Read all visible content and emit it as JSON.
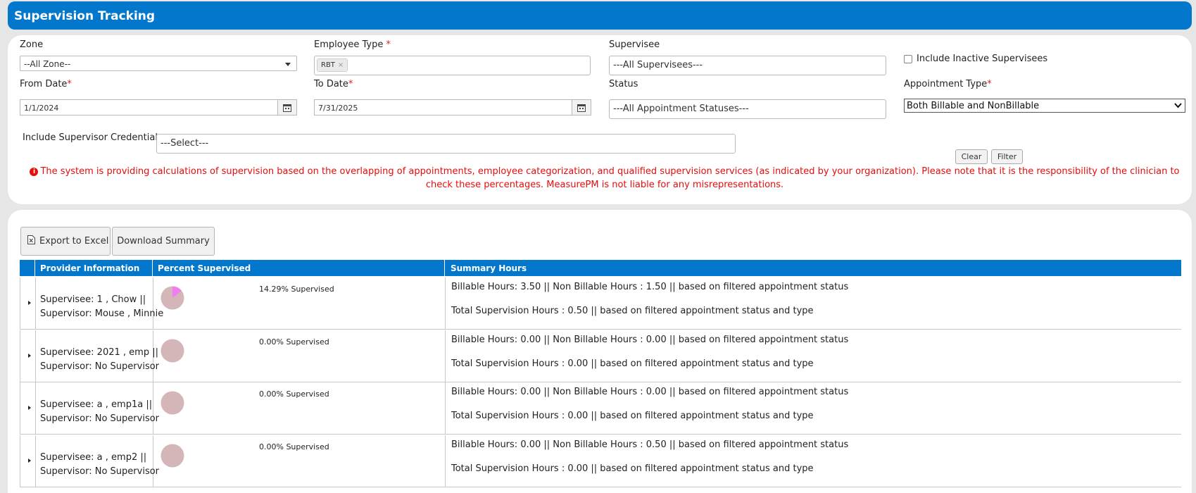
{
  "header": {
    "title": "Supervision Tracking"
  },
  "filters": {
    "zone": {
      "label": "Zone",
      "value": "--All Zone--"
    },
    "employee_type": {
      "label": "Employee Type",
      "required_mark": "*",
      "chip": "RBT",
      "chip_remove": "×"
    },
    "supervisee": {
      "label": "Supervisee",
      "value": "---All Supervisees---"
    },
    "include_inactive": {
      "label": "Include Inactive Supervisees",
      "checked": false
    },
    "from_date": {
      "label": "From Date",
      "required_mark": "*",
      "value": "1/1/2024"
    },
    "to_date": {
      "label": "To Date",
      "required_mark": "*",
      "value": "7/31/2025"
    },
    "status": {
      "label": "Status",
      "value": "---All Appointment Statuses---"
    },
    "appointment_type": {
      "label": "Appointment Type",
      "required_mark": "*",
      "value": "Both Billable and NonBillable"
    },
    "supervisor_credentials": {
      "label": "Include Supervisor Credentials",
      "value": "---Select---"
    },
    "clear_label": "Clear",
    "filter_label": "Filter",
    "notice_icon": "i",
    "notice": "The system is providing calculations of supervision based on the overlapping of appointments, employee categorization, and qualified supervision services (as indicated by your organization). Please note that it is the responsibility of the clinician to check these percentages. MeasurePM is not liable for any misrepresentations."
  },
  "toolbar": {
    "export_label": "Export to Excel",
    "download_label": "Download Summary"
  },
  "table": {
    "columns": [
      "Provider Information",
      "Percent Supervised",
      "Summary Hours"
    ],
    "rows": [
      {
        "supervisee": "Supervisee: 1 , Chow ||",
        "supervisor": "Supervisor: Mouse , Minnie",
        "percent": 14.29,
        "percent_label": "14.29% Supervised",
        "hours_line": "Billable Hours: 3.50 || Non Billable Hours : 1.50 || based on filtered appointment status",
        "total_line": "Total Supervision Hours : 0.50 || based on filtered appointment status and type"
      },
      {
        "supervisee": "Supervisee: 2021 , emp ||",
        "supervisor": "Supervisor: No Supervisor",
        "percent": 0,
        "percent_label": "0.00% Supervised",
        "hours_line": "Billable Hours: 0.00 || Non Billable Hours : 0.00 || based on filtered appointment status",
        "total_line": "Total Supervision Hours : 0.00 || based on filtered appointment status and type"
      },
      {
        "supervisee": "Supervisee: a , emp1a ||",
        "supervisor": "Supervisor: No Supervisor",
        "percent": 0,
        "percent_label": "0.00% Supervised",
        "hours_line": "Billable Hours: 0.00 || Non Billable Hours : 0.00 || based on filtered appointment status",
        "total_line": "Total Supervision Hours : 0.00 || based on filtered appointment status and type"
      },
      {
        "supervisee": "Supervisee: a , emp2 ||",
        "supervisor": "Supervisor: No Supervisor",
        "percent": 0,
        "percent_label": "0.00% Supervised",
        "hours_line": "Billable Hours: 0.00 || Non Billable Hours : 0.50 || based on filtered appointment status",
        "total_line": "Total Supervision Hours : 0.00 || based on filtered appointment status and type"
      }
    ]
  },
  "colors": {
    "brand": "#0277cc",
    "pie_base": "#d4b5b8",
    "pie_slice": "#f07ef0",
    "notice": "#e60d0d"
  }
}
